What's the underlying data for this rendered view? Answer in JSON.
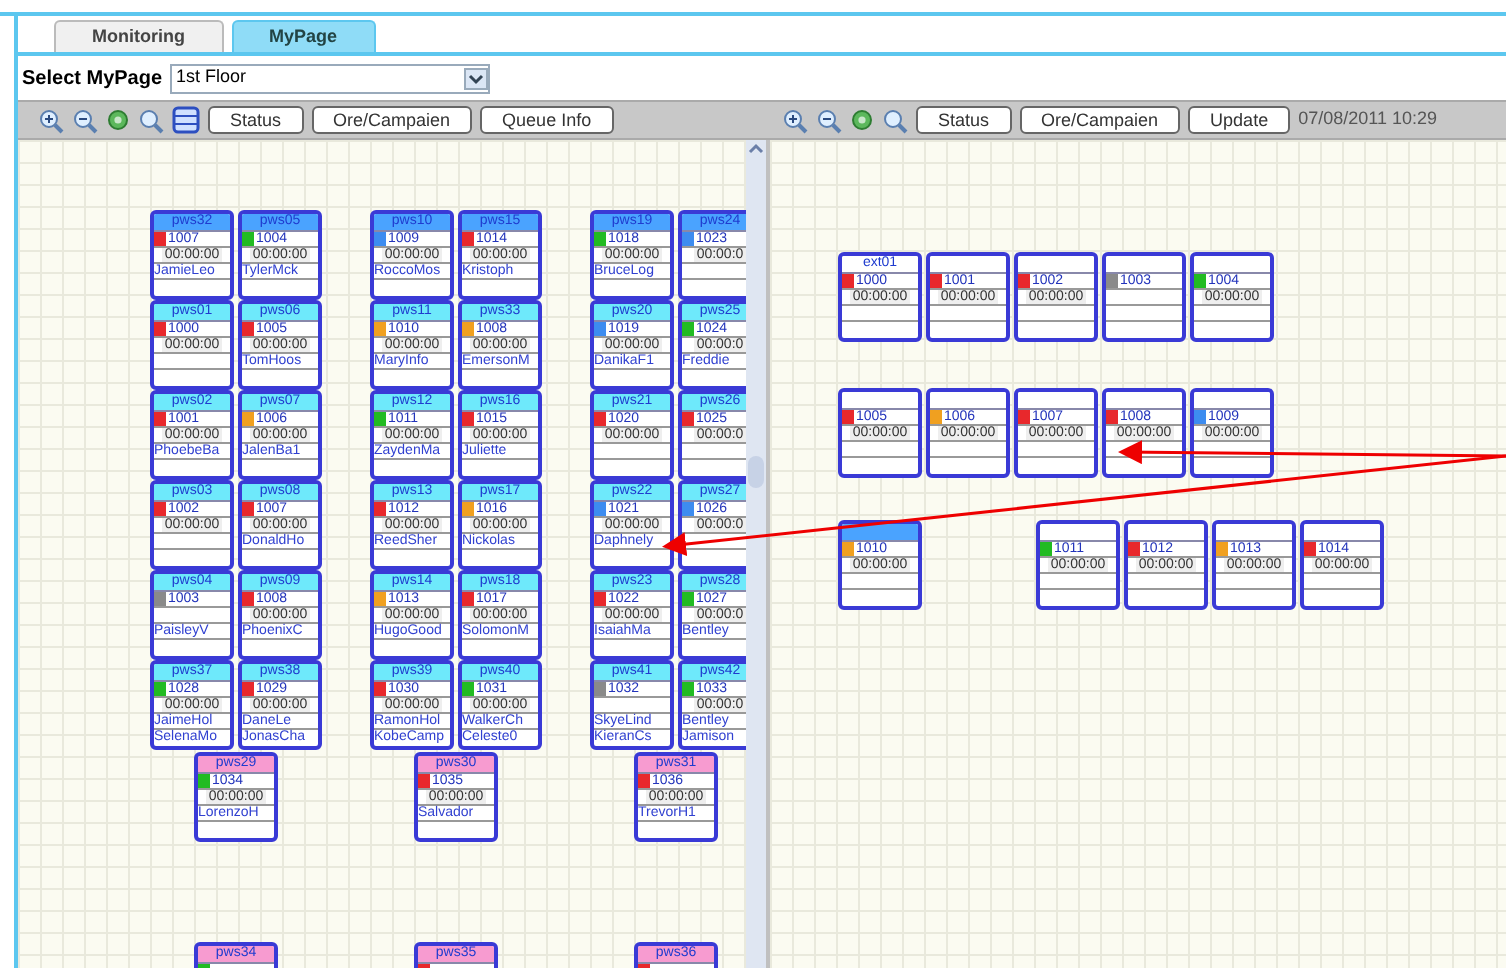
{
  "tabs": [
    {
      "label": "Monitoring",
      "selected": false
    },
    {
      "label": "MyPage",
      "selected": true
    }
  ],
  "select_mypage": {
    "label": "Select MyPage",
    "value": "1st Floor"
  },
  "left_toolbar": {
    "buttons": [
      "Status",
      "Ore/Campaien",
      "Queue Info"
    ]
  },
  "right_toolbar": {
    "buttons": [
      "Status",
      "Ore/Campaien",
      "Update"
    ],
    "timestamp": "07/08/2011 10:29"
  },
  "left": {
    "groups": [
      {
        "tiles": [
          {
            "header": "pws32",
            "kind": "lead",
            "ext": "1007",
            "color": "#e8282c",
            "time": "00:00:00",
            "names": [
              "JamieLeo"
            ]
          },
          {
            "header": "pws05",
            "kind": "lead",
            "ext": "1004",
            "color": "#22bb22",
            "time": "00:00:00",
            "names": [
              "TylerMck"
            ]
          },
          {
            "header": "pws01",
            "kind": "agent",
            "ext": "1000",
            "color": "#e8282c",
            "time": "00:00:00"
          },
          {
            "header": "pws06",
            "kind": "agent",
            "ext": "1005",
            "color": "#e8282c",
            "time": "00:00:00",
            "names": [
              "TomHoos"
            ]
          },
          {
            "header": "pws02",
            "kind": "agent",
            "ext": "1001",
            "color": "#e8282c",
            "time": "00:00:00",
            "names": [
              "PhoebeBa"
            ]
          },
          {
            "header": "pws07",
            "kind": "agent",
            "ext": "1006",
            "color": "#f0a020",
            "time": "00:00:00",
            "names": [
              "JalenBa1"
            ]
          },
          {
            "header": "pws03",
            "kind": "agent",
            "ext": "1002",
            "color": "#e8282c",
            "time": "00:00:00"
          },
          {
            "header": "pws08",
            "kind": "agent",
            "ext": "1007",
            "color": "#e8282c",
            "time": "00:00:00",
            "names": [
              "DonaldHo"
            ]
          },
          {
            "header": "pws04",
            "kind": "agent",
            "ext": "1003",
            "color": "#8a8a8a",
            "names": [
              "PaisleyV"
            ]
          },
          {
            "header": "pws09",
            "kind": "agent",
            "ext": "1008",
            "color": "#e8282c",
            "time": "00:00:00",
            "names": [
              "PhoenixC"
            ]
          },
          {
            "header": "pws37",
            "kind": "agent",
            "ext": "1028",
            "color": "#22bb22",
            "time": "00:00:00",
            "names": [
              "JaimeHol",
              "SelenaMo"
            ]
          },
          {
            "header": "pws38",
            "kind": "agent",
            "ext": "1029",
            "color": "#e8282c",
            "time": "00:00:00",
            "names": [
              "DaneLe",
              "JonasCha"
            ]
          }
        ],
        "extra": {
          "header": "pws29",
          "kind": "extra",
          "ext": "1034",
          "color": "#22bb22",
          "time": "00:00:00",
          "names": [
            "LorenzoH"
          ]
        },
        "bottom": {
          "header": "pws34",
          "kind": "extra",
          "color": "#22bb22"
        }
      },
      {
        "tiles": [
          {
            "header": "pws10",
            "kind": "lead",
            "ext": "1009",
            "color": "#3d8cf0",
            "time": "00:00:00",
            "names": [
              "RoccoMos"
            ]
          },
          {
            "header": "pws15",
            "kind": "lead",
            "ext": "1014",
            "color": "#e8282c",
            "time": "00:00:00",
            "names": [
              "Kristoph"
            ]
          },
          {
            "header": "pws11",
            "kind": "agent",
            "ext": "1010",
            "color": "#f0a020",
            "time": "00:00:00",
            "names": [
              "MaryInfo"
            ]
          },
          {
            "header": "pws33",
            "kind": "agent",
            "ext": "1008",
            "color": "#f0a020",
            "time": "00:00:00",
            "names": [
              "EmersonM"
            ]
          },
          {
            "header": "pws12",
            "kind": "agent",
            "ext": "1011",
            "color": "#22bb22",
            "time": "00:00:00",
            "names": [
              "ZaydenMa"
            ]
          },
          {
            "header": "pws16",
            "kind": "agent",
            "ext": "1015",
            "color": "#e8282c",
            "time": "00:00:00",
            "names": [
              "Juliette"
            ]
          },
          {
            "header": "pws13",
            "kind": "agent",
            "ext": "1012",
            "color": "#e8282c",
            "time": "00:00:00",
            "names": [
              "ReedSher"
            ]
          },
          {
            "header": "pws17",
            "kind": "agent",
            "ext": "1016",
            "color": "#f0a020",
            "time": "00:00:00",
            "names": [
              "Nickolas"
            ]
          },
          {
            "header": "pws14",
            "kind": "agent",
            "ext": "1013",
            "color": "#f0a020",
            "time": "00:00:00",
            "names": [
              "HugoGood"
            ]
          },
          {
            "header": "pws18",
            "kind": "agent",
            "ext": "1017",
            "color": "#e8282c",
            "time": "00:00:00",
            "names": [
              "SolomonM"
            ]
          },
          {
            "header": "pws39",
            "kind": "agent",
            "ext": "1030",
            "color": "#e8282c",
            "time": "00:00:00",
            "names": [
              "RamonHol",
              "KobeCamp"
            ]
          },
          {
            "header": "pws40",
            "kind": "agent",
            "ext": "1031",
            "color": "#22bb22",
            "time": "00:00:00",
            "names": [
              "WalkerCh",
              "Celeste0"
            ]
          }
        ],
        "extra": {
          "header": "pws30",
          "kind": "extra",
          "ext": "1035",
          "color": "#e8282c",
          "time": "00:00:00",
          "names": [
            "Salvador"
          ]
        },
        "bottom": {
          "header": "pws35",
          "kind": "extra",
          "color": "#e8282c"
        }
      },
      {
        "tiles": [
          {
            "header": "pws19",
            "kind": "lead",
            "ext": "1018",
            "color": "#22bb22",
            "time": "00:00:00",
            "names": [
              "BruceLog"
            ]
          },
          {
            "header": "pws24",
            "kind": "lead",
            "ext": "1023",
            "color": "#3d8cf0",
            "time": "00:00:0"
          },
          {
            "header": "pws20",
            "kind": "agent",
            "ext": "1019",
            "color": "#3d8cf0",
            "time": "00:00:00",
            "names": [
              "DanikaF1"
            ]
          },
          {
            "header": "pws25",
            "kind": "agent",
            "ext": "1024",
            "color": "#22bb22",
            "time": "00:00:0",
            "names": [
              "Freddie"
            ]
          },
          {
            "header": "pws21",
            "kind": "agent",
            "ext": "1020",
            "color": "#e8282c",
            "time": "00:00:00"
          },
          {
            "header": "pws26",
            "kind": "agent",
            "ext": "1025",
            "color": "#e8282c",
            "time": "00:00:0"
          },
          {
            "header": "pws22",
            "kind": "agent",
            "ext": "1021",
            "color": "#3d8cf0",
            "time": "00:00:00",
            "names": [
              "Daphnely"
            ]
          },
          {
            "header": "pws27",
            "kind": "agent",
            "ext": "1026",
            "color": "#3d8cf0",
            "time": "00:00:0"
          },
          {
            "header": "pws23",
            "kind": "agent",
            "ext": "1022",
            "color": "#e8282c",
            "time": "00:00:00",
            "names": [
              "IsaiahMa"
            ]
          },
          {
            "header": "pws28",
            "kind": "agent",
            "ext": "1027",
            "color": "#22bb22",
            "time": "00:00:0",
            "names": [
              "Bentley"
            ]
          },
          {
            "header": "pws41",
            "kind": "agent",
            "ext": "1032",
            "color": "#8a8a8a",
            "names": [
              "SkyeLind",
              "KieranCs"
            ]
          },
          {
            "header": "pws42",
            "kind": "agent",
            "ext": "1033",
            "color": "#22bb22",
            "time": "00:00:0",
            "names": [
              "Bentley",
              "Jamison"
            ]
          }
        ],
        "extra": {
          "header": "pws31",
          "kind": "extra",
          "ext": "1036",
          "color": "#e8282c",
          "time": "00:00:00",
          "names": [
            "TrevorH1"
          ]
        },
        "bottom": {
          "header": "pws36",
          "kind": "extra",
          "color": "#e8282c"
        }
      }
    ]
  },
  "right": {
    "rows": [
      {
        "groups": [
          {
            "tiles": [
              {
                "header": "ext01",
                "kind": "plain",
                "ext": "1000",
                "color": "#e8282c",
                "time": "00:00:00"
              },
              {
                "kind": "plain",
                "ext": "1001",
                "color": "#e8282c",
                "time": "00:00:00"
              },
              {
                "kind": "plain",
                "ext": "1002",
                "color": "#e8282c",
                "time": "00:00:00"
              },
              {
                "kind": "plain",
                "ext": "1003",
                "color": "#8a8a8a"
              },
              {
                "kind": "plain",
                "ext": "1004",
                "color": "#22bb22",
                "time": "00:00:00"
              }
            ]
          }
        ]
      },
      {
        "groups": [
          {
            "tiles": [
              {
                "kind": "plain",
                "ext": "1005",
                "color": "#e8282c",
                "time": "00:00:00"
              },
              {
                "kind": "plain",
                "ext": "1006",
                "color": "#f0a020",
                "time": "00:00:00"
              },
              {
                "kind": "plain",
                "ext": "1007",
                "color": "#e8282c",
                "time": "00:00:00"
              },
              {
                "kind": "plain",
                "ext": "1008",
                "color": "#e8282c",
                "time": "00:00:00"
              },
              {
                "kind": "plain",
                "ext": "1009",
                "color": "#3d8cf0",
                "time": "00:00:00"
              }
            ]
          }
        ]
      },
      {
        "groups": [
          {
            "tiles": [
              {
                "kind": "active",
                "ext": "1010",
                "color": "#f0a020",
                "time": "00:00:00"
              }
            ]
          },
          {
            "tiles": [
              {
                "kind": "plain",
                "ext": "1011",
                "color": "#22bb22",
                "time": "00:00:00"
              },
              {
                "kind": "plain",
                "ext": "1012",
                "color": "#e8282c",
                "time": "00:00:00"
              },
              {
                "kind": "plain",
                "ext": "1013",
                "color": "#f0a020",
                "time": "00:00:00"
              },
              {
                "kind": "plain",
                "ext": "1014",
                "color": "#e8282c",
                "time": "00:00:00"
              }
            ]
          }
        ]
      }
    ]
  }
}
